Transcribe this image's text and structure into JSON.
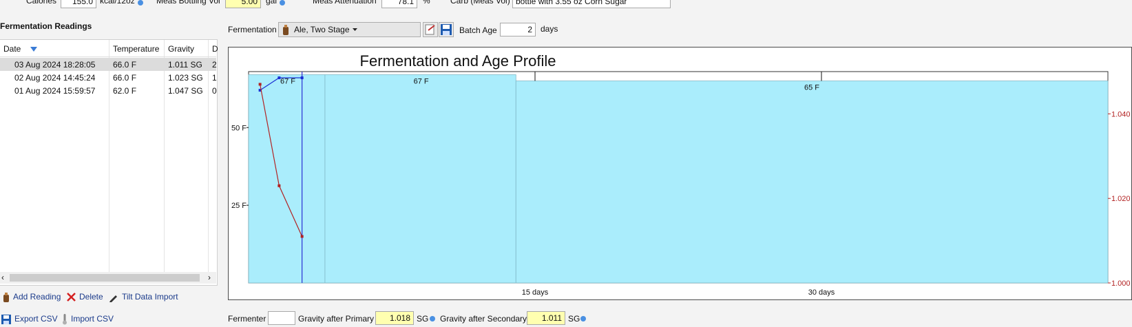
{
  "top_row": {
    "calories_label": "Calories",
    "calories_value": "155.0",
    "calories_unit": "kcal/12oz",
    "bottling_vol_label": "Meas Bottling Vol",
    "bottling_vol_value": "5.00",
    "bottling_vol_unit": "gal",
    "attenuation_label": "Meas Attenuation",
    "attenuation_value": "78.1",
    "attenuation_unit": "%",
    "carb_label": "Carb (Meas Vol)",
    "carb_value": "bottle with 3.55 oz Corn Sugar"
  },
  "readings": {
    "title": "Fermentation Readings",
    "columns": [
      "Date",
      "Temperature",
      "Gravity",
      "D"
    ],
    "rows": [
      {
        "date": "03 Aug 2024 18:28:05",
        "temp": "66.0 F",
        "gravity": "1.011 SG",
        "d": "2"
      },
      {
        "date": "02 Aug 2024 14:45:24",
        "temp": "66.0 F",
        "gravity": "1.023 SG",
        "d": "1"
      },
      {
        "date": "01 Aug 2024 15:59:57",
        "temp": "62.0 F",
        "gravity": "1.047 SG",
        "d": "0"
      }
    ],
    "actions": {
      "add": "Add Reading",
      "delete": "Delete",
      "tilt": "Tilt Data Import",
      "export": "Export CSV",
      "import": "Import CSV"
    }
  },
  "fermentation": {
    "label": "Fermentation",
    "profile": "Ale, Two Stage",
    "batch_age_label": "Batch Age",
    "batch_age_value": "2",
    "batch_age_unit": "days"
  },
  "bottom": {
    "fermenter_label": "Fermenter",
    "fermenter_value": "",
    "primary_label": "Gravity after Primary",
    "primary_value": "1.018",
    "primary_unit": "SG",
    "secondary_label": "Gravity after Secondary",
    "secondary_value": "1.011",
    "secondary_unit": "SG"
  },
  "colors": {
    "stage_fill": "#aaedfc",
    "gravity_line": "#b22222",
    "temp_line": "#1a2fd4",
    "age_marker": "#2a2fd4",
    "right_axis": "#b22222",
    "link_blue": "#1a3a8a"
  },
  "chart_data": {
    "type": "line",
    "title": "Fermentation and Age Profile",
    "x_unit": "days",
    "xlim": [
      0,
      45
    ],
    "x_ticks": [
      {
        "value": 15,
        "label": "15 days"
      },
      {
        "value": 30,
        "label": "30 days"
      }
    ],
    "y_left_ticks": [
      {
        "value": 25,
        "label": "25 F"
      },
      {
        "value": 50,
        "label": "50 F"
      }
    ],
    "y_left_lim": [
      0,
      68
    ],
    "y_right_ticks": [
      {
        "value": 1.0,
        "label": "1.000"
      },
      {
        "value": 1.02,
        "label": "1.020"
      },
      {
        "value": 1.04,
        "label": "1.040"
      }
    ],
    "y_right_lim": [
      1.0,
      1.05
    ],
    "stages": [
      {
        "start": 0,
        "end": 4,
        "temp": 67,
        "label": "67 F"
      },
      {
        "start": 4,
        "end": 14,
        "temp": 67,
        "label": "67 F"
      },
      {
        "start": 14,
        "end": 45,
        "temp": 65,
        "label": "65 F"
      }
    ],
    "current_age_day": 2.8,
    "series": [
      {
        "kind": "temperature",
        "x": [
          0.6,
          1.6,
          2.8
        ],
        "y": [
          62.0,
          66.0,
          66.0
        ]
      },
      {
        "kind": "gravity",
        "x": [
          0.6,
          1.6,
          2.8
        ],
        "y": [
          1.047,
          1.023,
          1.011
        ]
      }
    ]
  }
}
